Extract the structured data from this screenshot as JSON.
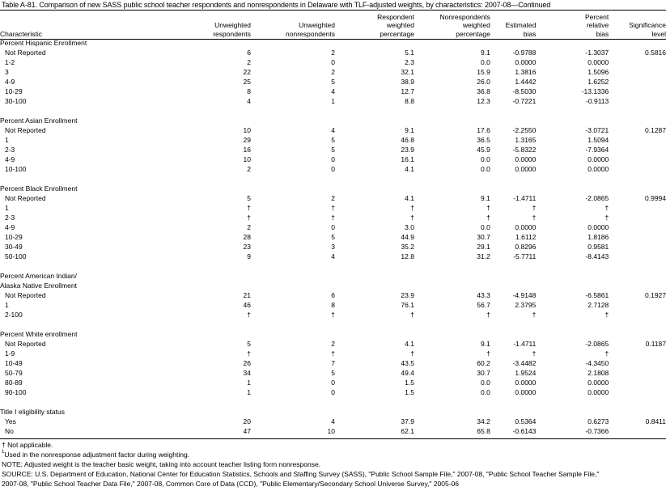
{
  "title": "Table A-81. Comparison of new SASS public school teacher respondents and nonrespondents in Delaware with TLF-adjusted weights, by characteristics: 2007-08—Continued",
  "columns": [
    [
      "Characteristic"
    ],
    [
      "Unweighted",
      "respondents"
    ],
    [
      "Unweighted",
      "nonrespondents"
    ],
    [
      "Respondent",
      "weighted",
      "percentage"
    ],
    [
      "Nonrespondents",
      "weighted",
      "percentage"
    ],
    [
      "Estimated",
      "bias"
    ],
    [
      "Percent",
      "relative",
      "bias"
    ],
    [
      "Significance",
      "level"
    ]
  ],
  "groups": [
    {
      "label": [
        "Percent Hispanic Enrollment"
      ],
      "rows": [
        [
          "Not Reported",
          "6",
          "2",
          "5.1",
          "9.1",
          "-0.9788",
          "-1.3037",
          "0.5816"
        ],
        [
          "1-2",
          "2",
          "0",
          "2.3",
          "0.0",
          "0.0000",
          "0.0000",
          ""
        ],
        [
          "3",
          "22",
          "2",
          "32.1",
          "15.9",
          "1.3816",
          "1.5096",
          ""
        ],
        [
          "4-9",
          "25",
          "5",
          "38.9",
          "26.0",
          "1.4442",
          "1.6252",
          ""
        ],
        [
          "10-29",
          "8",
          "4",
          "12.7",
          "36.8",
          "-8.5030",
          "-13.1336",
          ""
        ],
        [
          "30-100",
          "4",
          "1",
          "8.8",
          "12.3",
          "-0.7221",
          "-0.9113",
          ""
        ]
      ]
    },
    {
      "label": [
        "Percent Asian Enrollment"
      ],
      "rows": [
        [
          "Not Reported",
          "10",
          "4",
          "9.1",
          "17.6",
          "-2.2550",
          "-3.0721",
          "0.1287"
        ],
        [
          "1",
          "29",
          "5",
          "46.8",
          "36.5",
          "1.3165",
          "1.5094",
          ""
        ],
        [
          "2-3",
          "16",
          "5",
          "23.9",
          "45.9",
          "-5.8322",
          "-7.9364",
          ""
        ],
        [
          "4-9",
          "10",
          "0",
          "16.1",
          "0.0",
          "0.0000",
          "0.0000",
          ""
        ],
        [
          "10-100",
          "2",
          "0",
          "4.1",
          "0.0",
          "0.0000",
          "0.0000",
          ""
        ]
      ]
    },
    {
      "label": [
        "Percent Black Enrollment"
      ],
      "rows": [
        [
          "Not Reported",
          "5",
          "2",
          "4.1",
          "9.1",
          "-1.4711",
          "-2.0865",
          "0.9994"
        ],
        [
          "1",
          "†",
          "†",
          "†",
          "†",
          "†",
          "†",
          ""
        ],
        [
          "2-3",
          "†",
          "†",
          "†",
          "†",
          "†",
          "†",
          ""
        ],
        [
          "4-9",
          "2",
          "0",
          "3.0",
          "0.0",
          "0.0000",
          "0.0000",
          ""
        ],
        [
          "10-29",
          "28",
          "5",
          "44.9",
          "30.7",
          "1.6112",
          "1.8186",
          ""
        ],
        [
          "30-49",
          "23",
          "3",
          "35.2",
          "29.1",
          "0.8296",
          "0.9581",
          ""
        ],
        [
          "50-100",
          "9",
          "4",
          "12.8",
          "31.2",
          "-5.7711",
          "-8.4143",
          ""
        ]
      ]
    },
    {
      "label": [
        "Percent American Indian/",
        "Alaska Native Enrollment"
      ],
      "rows": [
        [
          "Not Reported",
          "21",
          "6",
          "23.9",
          "43.3",
          "-4.9148",
          "-6.5861",
          "0.1927"
        ],
        [
          "1",
          "46",
          "8",
          "76.1",
          "56.7",
          "2.3795",
          "2.7128",
          ""
        ],
        [
          "2-100",
          "†",
          "†",
          "†",
          "†",
          "†",
          "†",
          ""
        ]
      ]
    },
    {
      "label": [
        "Percent White enrollment"
      ],
      "rows": [
        [
          "Not Reported",
          "5",
          "2",
          "4.1",
          "9.1",
          "-1.4711",
          "-2.0865",
          "0.1187"
        ],
        [
          "1-9",
          "†",
          "†",
          "†",
          "†",
          "†",
          "†",
          ""
        ],
        [
          "10-49",
          "26",
          "7",
          "43.5",
          "60.2",
          "-3.4482",
          "-4.3450",
          ""
        ],
        [
          "50-79",
          "34",
          "5",
          "49.4",
          "30.7",
          "1.9524",
          "2.1808",
          ""
        ],
        [
          "80-89",
          "1",
          "0",
          "1.5",
          "0.0",
          "0.0000",
          "0.0000",
          ""
        ],
        [
          "90-100",
          "1",
          "0",
          "1.5",
          "0.0",
          "0.0000",
          "0.0000",
          ""
        ]
      ]
    },
    {
      "label": [
        "Title I eligibility status"
      ],
      "rows": [
        [
          "Yes",
          "20",
          "4",
          "37.9",
          "34.2",
          "0.5364",
          "0.6273",
          "0.8411"
        ],
        [
          "No",
          "47",
          "10",
          "62.1",
          "65.8",
          "-0.6143",
          "-0.7366",
          ""
        ]
      ]
    }
  ],
  "notes": {
    "dagger": "† Not applicable.",
    "footnote_mark": "1",
    "footnote": "Used in the nonresponse adjustment factor during weighting.",
    "note": "NOTE: Adjusted weight is the teacher basic weight, taking into account teacher listing form nonresponse.",
    "source_1": "SOURCE: U.S. Department of Education, National Center for Education Statistics, Schools and Staffing Survey (SASS), \"Public School Sample File,\" 2007-08, \"Public School Teacher Sample File,\"",
    "source_2": "2007-08, \"Public School Teacher Data File,\" 2007-08, Common Core of Data (CCD), \"Public Elementary/Secondary School Universe Survey,\" 2005-06"
  }
}
